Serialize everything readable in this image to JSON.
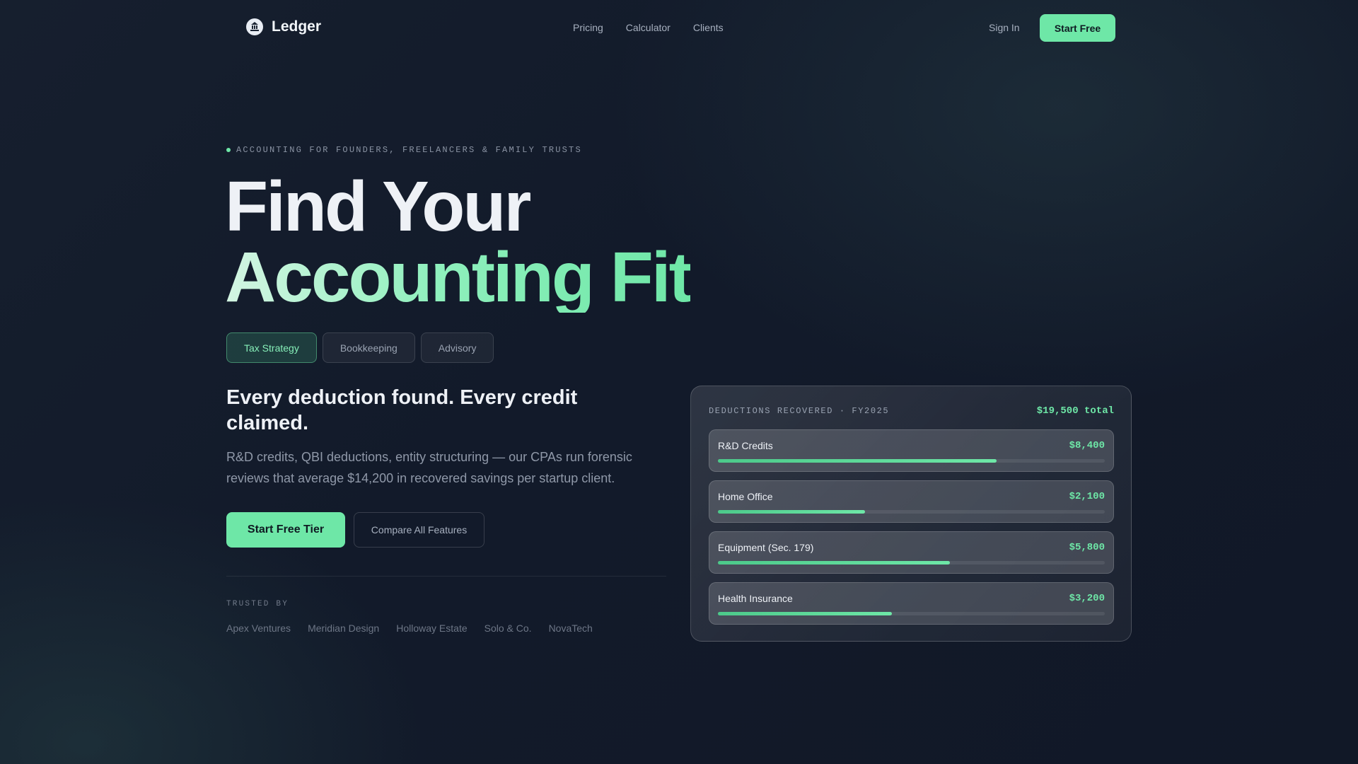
{
  "nav": {
    "brand": "Ledger",
    "links": [
      "Pricing",
      "Calculator",
      "Clients"
    ],
    "sign_in": "Sign In",
    "start_free": "Start Free"
  },
  "hero": {
    "eyebrow": "ACCOUNTING FOR FOUNDERS, FREELANCERS & FAMILY TRUSTS",
    "title_line1": "Find Your",
    "title_line2": "Accounting Fit",
    "tabs": [
      {
        "label": "Tax Strategy",
        "active": true
      },
      {
        "label": "Bookkeeping",
        "active": false
      },
      {
        "label": "Advisory",
        "active": false
      }
    ],
    "subheading": "Every deduction found. Every credit claimed.",
    "paragraph": "R&D credits, QBI deductions, entity structuring — our CPAs run forensic reviews that average $14,200 in recovered savings per startup client.",
    "cta_primary": "Start Free Tier",
    "cta_secondary": "Compare All Features",
    "trusted_label": "TRUSTED BY",
    "trusted_logos": [
      "Apex Ventures",
      "Meridian Design",
      "Holloway Estate",
      "Solo & Co.",
      "NovaTech"
    ]
  },
  "card": {
    "title": "DEDUCTIONS RECOVERED · FY2025",
    "total": "$19,500 total",
    "rows": [
      {
        "label": "R&D Credits",
        "value": "$8,400",
        "fill": 0.72
      },
      {
        "label": "Home Office",
        "value": "$2,100",
        "fill": 0.38
      },
      {
        "label": "Equipment (Sec. 179)",
        "value": "$5,800",
        "fill": 0.6
      },
      {
        "label": "Health Insurance",
        "value": "$3,200",
        "fill": 0.45
      }
    ]
  },
  "colors": {
    "accent": "#6ee7a7",
    "background": "#121a2a",
    "text": "#eef1f6"
  },
  "icons": {
    "brand": "ledger-logo-icon"
  }
}
